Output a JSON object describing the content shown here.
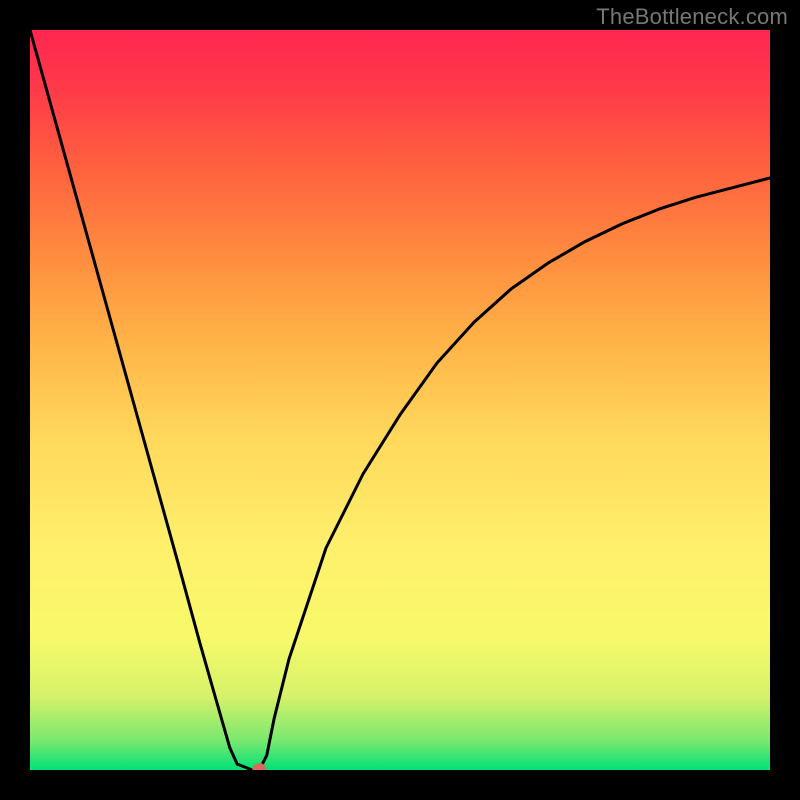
{
  "watermark": "TheBottleneck.com",
  "chart_data": {
    "type": "line",
    "title": "",
    "xlabel": "",
    "ylabel": "",
    "ylim": [
      0,
      100
    ],
    "xlim": [
      0,
      100
    ],
    "x": [
      0,
      5,
      10,
      15,
      20,
      23,
      25,
      27,
      28,
      29,
      30,
      31,
      32,
      33,
      35,
      40,
      45,
      50,
      55,
      60,
      65,
      70,
      75,
      80,
      85,
      90,
      95,
      100
    ],
    "values": [
      100,
      82,
      64,
      46,
      28,
      17,
      10,
      3,
      0.8,
      0.4,
      0,
      0,
      2,
      7,
      15,
      30,
      40,
      48,
      55,
      60.5,
      65,
      68.5,
      71.4,
      73.8,
      75.8,
      77.4,
      78.7,
      80
    ],
    "marker": {
      "x": 31,
      "y": 0,
      "color": "#d86a5b",
      "r": 7
    },
    "gradient_stops": [
      {
        "pos": 0.0,
        "color": "#00e277"
      },
      {
        "pos": 0.04,
        "color": "#7ae86f"
      },
      {
        "pos": 0.1,
        "color": "#d6f26a"
      },
      {
        "pos": 0.18,
        "color": "#f7f96a"
      },
      {
        "pos": 0.3,
        "color": "#fff06c"
      },
      {
        "pos": 0.45,
        "color": "#ffd85c"
      },
      {
        "pos": 0.58,
        "color": "#ffb347"
      },
      {
        "pos": 0.7,
        "color": "#ff8a3f"
      },
      {
        "pos": 0.82,
        "color": "#ff5f3f"
      },
      {
        "pos": 0.92,
        "color": "#ff3a4a"
      },
      {
        "pos": 1.0,
        "color": "#ff2650"
      }
    ]
  }
}
